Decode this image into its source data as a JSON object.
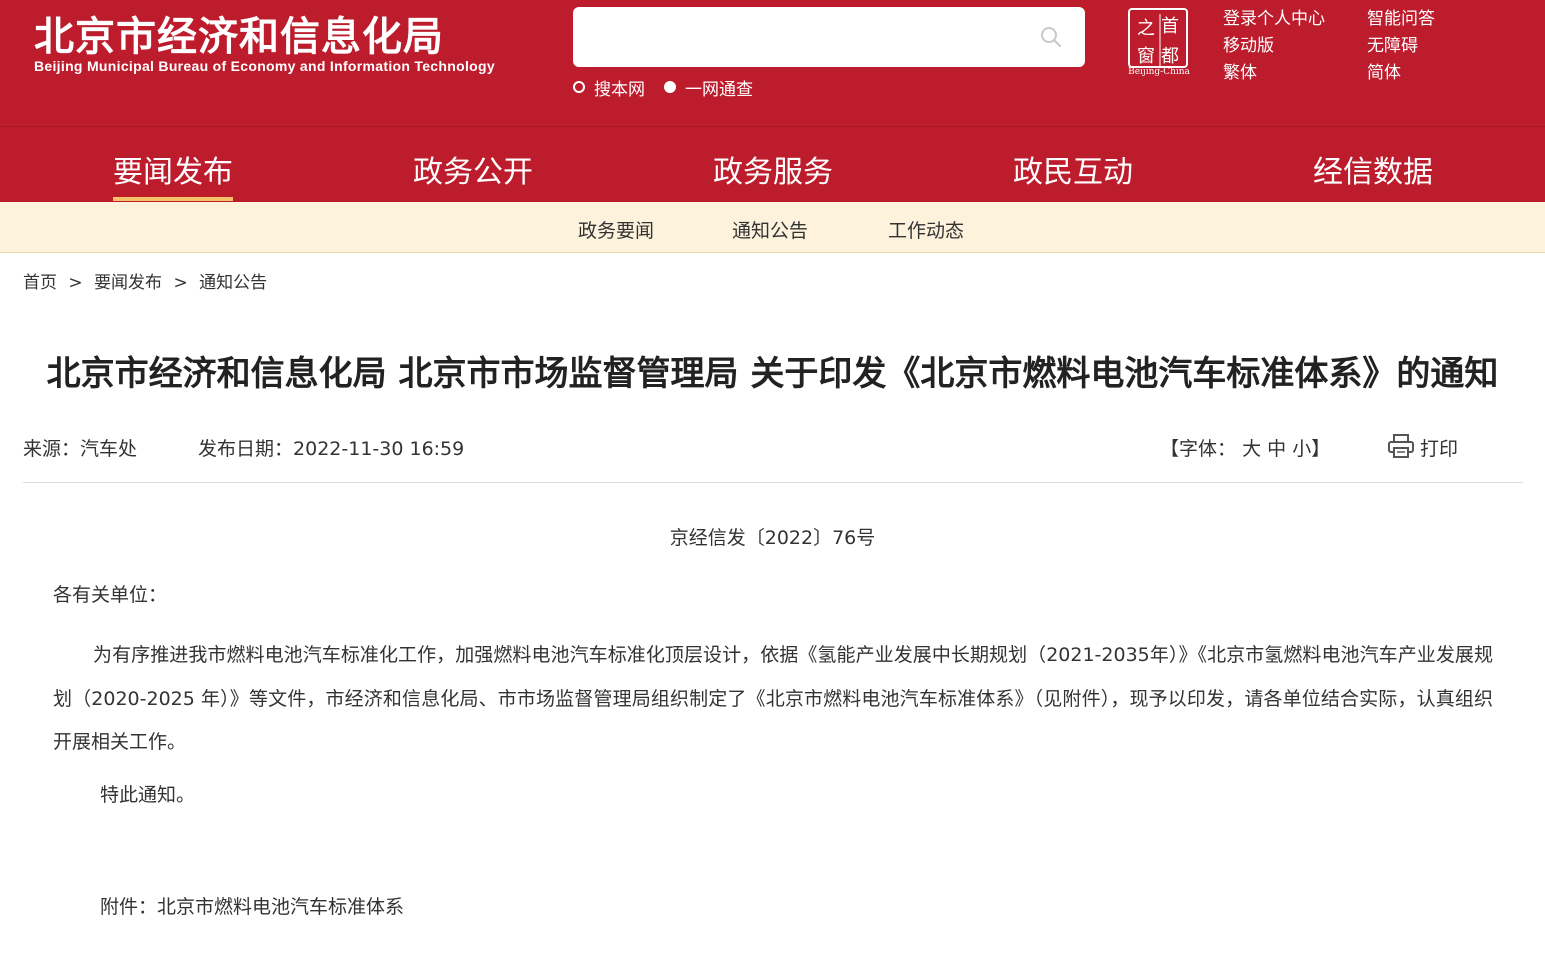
{
  "header": {
    "logo_cn": "北京市经济和信息化局",
    "logo_en": "Beijing Municipal Bureau of Economy and Information Technology",
    "search": {
      "placeholder": "",
      "scope_options": [
        "搜本网",
        "一网通查"
      ],
      "selected_scope": "一网通查"
    },
    "seal": {
      "chars": [
        "之",
        "首",
        "窗",
        "都"
      ],
      "caption": "Beijing-China"
    },
    "util_links": [
      "登录个人中心",
      "智能问答",
      "移动版",
      "无障碍",
      "繁体",
      "简体"
    ]
  },
  "main_nav": {
    "items": [
      "要闻发布",
      "政务公开",
      "政务服务",
      "政民互动",
      "经信数据"
    ],
    "active": "要闻发布"
  },
  "sub_nav": {
    "items": [
      "政务要闻",
      "通知公告",
      "工作动态"
    ]
  },
  "breadcrumb": [
    "首页",
    "要闻发布",
    "通知公告"
  ],
  "breadcrumb_separator": ">",
  "article": {
    "title": "北京市经济和信息化局 北京市市场监督管理局 关于印发《北京市燃料电池汽车标准体系》的通知",
    "source_label": "来源：",
    "source": "汽车处",
    "date_label": "发布日期：",
    "date": "2022-11-30 16:59",
    "font_size_prefix": "【字体：",
    "font_sizes": [
      "大",
      "中",
      "小"
    ],
    "font_size_suffix": "】",
    "print_label": "打印",
    "doc_number": "京经信发〔2022〕76号",
    "salutation": "各有关单位：",
    "body": "为有序推进我市燃料电池汽车标准化工作，加强燃料电池汽车标准化顶层设计，依据《氢能产业发展中长期规划（2021-2035年）》《北京市氢燃料电池汽车产业发展规划（2020-2025 年）》等文件，市经济和信息化局、市市场监督管理局组织制定了《北京市燃料电池汽车标准体系》（见附件），现予以印发，请各单位结合实际，认真组织开展相关工作。",
    "closing": "特此通知。",
    "attachment": "附件：北京市燃料电池汽车标准体系"
  },
  "colors": {
    "brand_red": "#bd1c2c",
    "subnav_bg": "#fdf3dc",
    "active_underline": "#f6c36a"
  }
}
